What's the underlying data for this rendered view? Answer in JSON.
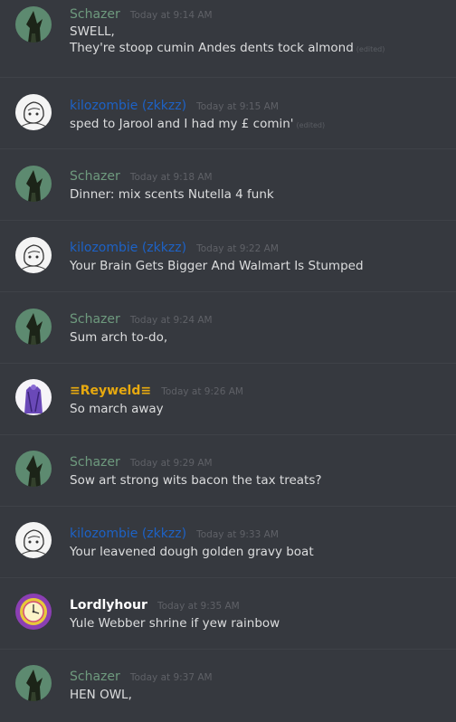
{
  "messages": [
    {
      "author": "Schazer",
      "author_color": "#6e9a7e",
      "timestamp": "Today at 9:14 AM",
      "lines": [
        "SWELL,",
        "They're stoop cumin Andes dents tock almond"
      ],
      "edited": "(edited)",
      "avatar": "wizard-avatar"
    },
    {
      "author": "kilozombie (zkkzz)",
      "author_color": "#1d62c6",
      "timestamp": "Today at 9:15 AM",
      "lines": [
        "sped to Jarool and I had my £ comin'"
      ],
      "edited": "(edited)",
      "avatar": "sketch-avatar"
    },
    {
      "author": "Schazer",
      "author_color": "#6e9a7e",
      "timestamp": "Today at 9:18 AM",
      "lines": [
        "Dinner: mix scents Nutella 4 funk"
      ],
      "avatar": "wizard-avatar"
    },
    {
      "author": "kilozombie (zkkzz)",
      "author_color": "#1d62c6",
      "timestamp": "Today at 9:22 AM",
      "lines": [
        "Your Brain Gets Bigger And Walmart Is Stumped"
      ],
      "avatar": "sketch-avatar"
    },
    {
      "author": "Schazer",
      "author_color": "#6e9a7e",
      "timestamp": "Today at 9:24 AM",
      "lines": [
        "Sum arch to-do,"
      ],
      "avatar": "wizard-avatar"
    },
    {
      "author": "≡Reyweld≡",
      "author_color": "#e7a90f",
      "timestamp": "Today at 9:26 AM",
      "lines": [
        "So march away"
      ],
      "avatar": "purple-figure-avatar"
    },
    {
      "author": "Schazer",
      "author_color": "#6e9a7e",
      "timestamp": "Today at 9:29 AM",
      "lines": [
        "Sow art strong wits bacon the tax treats?"
      ],
      "avatar": "wizard-avatar"
    },
    {
      "author": "kilozombie (zkkzz)",
      "author_color": "#1d62c6",
      "timestamp": "Today at 9:33 AM",
      "lines": [
        "Your leavened dough golden gravy boat"
      ],
      "avatar": "sketch-avatar"
    },
    {
      "author": "Lordlyhour",
      "author_color": "#ffffff",
      "timestamp": "Today at 9:35 AM",
      "lines": [
        "Yule Webber shrine if yew rainbow"
      ],
      "avatar": "clock-avatar"
    },
    {
      "author": "Schazer",
      "author_color": "#6e9a7e",
      "timestamp": "Today at 9:37 AM",
      "lines": [
        "HEN OWL,"
      ],
      "avatar": "wizard-avatar"
    }
  ]
}
